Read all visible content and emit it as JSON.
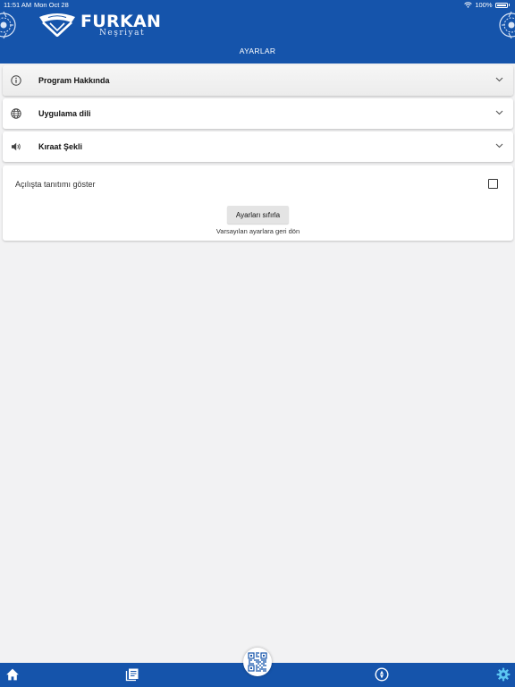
{
  "status_bar": {
    "time": "11:51 AM",
    "date": "Mon Oct 28",
    "battery": "100%",
    "icons": [
      "wifi-icon",
      "battery-icon"
    ]
  },
  "header": {
    "brand": "FURKAN",
    "brand_sub": "Neşriyat",
    "title": "AYARLAR",
    "colors": {
      "primary": "#1554ab",
      "background": "#f2f2f3"
    }
  },
  "sections": [
    {
      "label": "Program Hakkında",
      "icon": "info-icon"
    },
    {
      "label": "Uygulama dili",
      "icon": "globe-icon"
    },
    {
      "label": "Kıraat Şekli",
      "icon": "speaker-icon"
    }
  ],
  "settings_card": {
    "intro_label": "Açılışta tanıtımı göster",
    "intro_checked": false,
    "reset_button": "Ayarları sıfırla",
    "reset_hint": "Varsayılan ayarlara geri dön"
  },
  "bottom_nav": {
    "items": [
      "home-icon",
      "book-icon",
      "qr-code-icon",
      "compass-icon",
      "gear-icon"
    ],
    "active": "gear-icon"
  }
}
